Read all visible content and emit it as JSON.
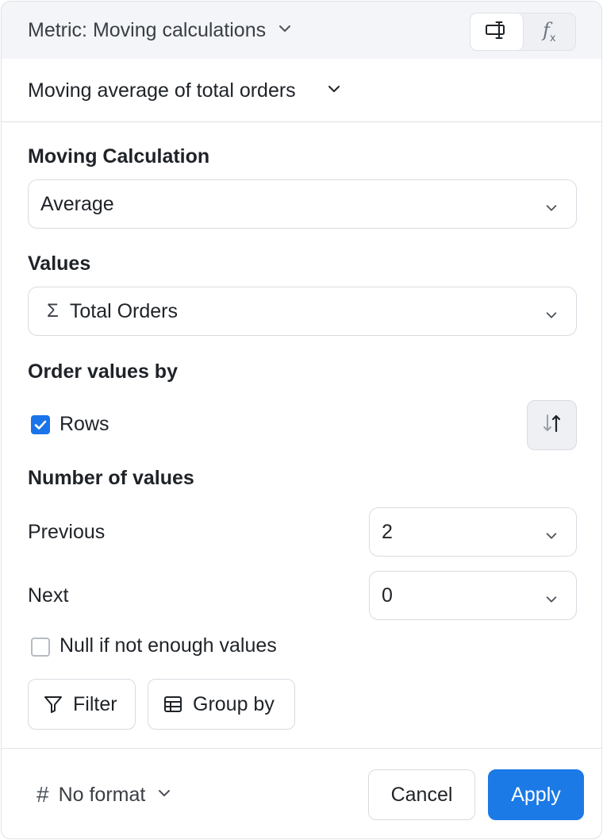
{
  "header": {
    "title": "Metric: Moving calculations",
    "toggle": {
      "visual_icon": "visual-builder-icon",
      "formula_icon": "fx-icon",
      "formula_glyph": "f",
      "formula_sub": "x"
    }
  },
  "metric": {
    "name": "Moving average of total orders"
  },
  "moving_calculation": {
    "label": "Moving Calculation",
    "value": "Average"
  },
  "values": {
    "label": "Values",
    "icon": "sigma-icon",
    "icon_glyph": "Σ",
    "value": "Total Orders"
  },
  "order_by": {
    "label": "Order values by",
    "option_label": "Rows",
    "checked": true,
    "sort_icon": "sort-ascending-icon"
  },
  "number_of_values": {
    "label": "Number of values",
    "previous_label": "Previous",
    "previous_value": "2",
    "next_label": "Next",
    "next_value": "0"
  },
  "null_option": {
    "label": "Null if not enough values",
    "checked": false
  },
  "actions": {
    "filter_label": "Filter",
    "group_by_label": "Group by"
  },
  "footer": {
    "hash_glyph": "#",
    "format_label": "No format",
    "cancel_label": "Cancel",
    "apply_label": "Apply"
  },
  "colors": {
    "accent": "#1b7ae6",
    "header_bg": "#f3f5f8",
    "border": "#dfe2e6"
  }
}
